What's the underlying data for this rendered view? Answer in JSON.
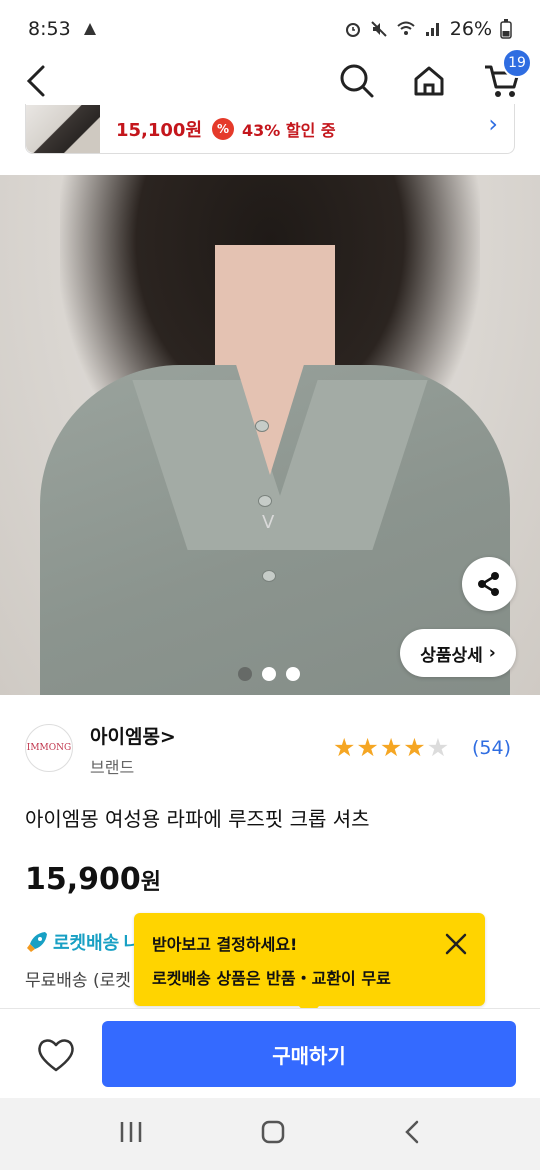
{
  "status_bar": {
    "time": "8:53",
    "battery": "26%"
  },
  "header": {
    "cart_count": "19"
  },
  "promo": {
    "price": "15,100원",
    "pct_symbol": "%",
    "discount_text": "43% 할인 중",
    "arrow": "›"
  },
  "hero": {
    "detail_label": "상품상세",
    "detail_chevron": "›",
    "pendant": "V",
    "slide_count": 3,
    "active_slide": 1
  },
  "brand": {
    "logo_text": "IMMONG",
    "name": "아이엠몽",
    "chevron": ">",
    "sub": "브랜드"
  },
  "rating": {
    "value": 4,
    "max": 5,
    "count": "(54)"
  },
  "product": {
    "title": "아이엠몽 여성용 라파에 루즈핏 크롭 셔츠",
    "price": "15,900",
    "price_unit": "원"
  },
  "shipping": {
    "rocket_label": "로켓배송",
    "rocket_suffix": "니",
    "free_label": "무료배송 (로켓"
  },
  "tooltip": {
    "line1": "받아보고 결정하세요!",
    "line2": "로켓배송 상품은 반품・교환이 무료"
  },
  "bottom": {
    "buy_label": "구매하기"
  },
  "colors": {
    "accent": "#346aff",
    "link": "#2f6de1",
    "sale": "#c4161c",
    "star": "#f5a623",
    "tooltip": "#ffd400",
    "rocket": "#18a0c4"
  }
}
